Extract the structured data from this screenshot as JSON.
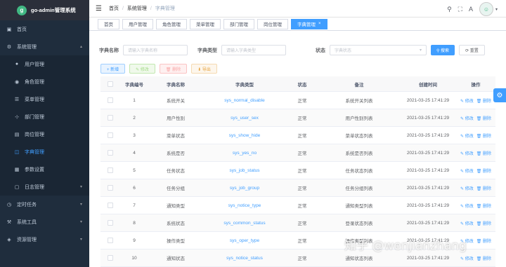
{
  "app": {
    "title": "go-admin管理系统",
    "logo_letter": "g"
  },
  "sidebar": {
    "items": [
      {
        "label": "首页",
        "icon": "dashboard-icon",
        "glyph": "▣",
        "level": "top"
      },
      {
        "label": "系统管理",
        "icon": "gear-icon",
        "glyph": "⚙",
        "level": "top",
        "arrow": "▴"
      },
      {
        "label": "用户管理",
        "icon": "user-icon",
        "glyph": "●",
        "level": "sub"
      },
      {
        "label": "角色管理",
        "icon": "role-icon",
        "glyph": "◉",
        "level": "sub"
      },
      {
        "label": "菜单管理",
        "icon": "menu-icon",
        "glyph": "☰",
        "level": "sub"
      },
      {
        "label": "部门管理",
        "icon": "tree-icon",
        "glyph": "⊹",
        "level": "sub"
      },
      {
        "label": "岗位管理",
        "icon": "post-icon",
        "glyph": "▤",
        "level": "sub"
      },
      {
        "label": "字典管理",
        "icon": "dict-icon",
        "glyph": "◫",
        "level": "sub",
        "active": true
      },
      {
        "label": "参数设置",
        "icon": "params-icon",
        "glyph": "▦",
        "level": "sub"
      },
      {
        "label": "日志管理",
        "icon": "log-icon",
        "glyph": "▢",
        "level": "sub",
        "arrow": "▾"
      },
      {
        "label": "定时任务",
        "icon": "clock-icon",
        "glyph": "◷",
        "level": "top",
        "arrow": "▾"
      },
      {
        "label": "系统工具",
        "icon": "tool-icon",
        "glyph": "⚒",
        "level": "top",
        "arrow": "▾"
      },
      {
        "label": "资源管理",
        "icon": "resource-icon",
        "glyph": "◈",
        "level": "top",
        "arrow": "▾"
      }
    ]
  },
  "header": {
    "hamburger": "☰",
    "breadcrumb": [
      "首页",
      "系统管理",
      "字典管理"
    ],
    "search_glyph": "⚲",
    "fullscreen_glyph": "⛶",
    "lang_glyph": "A",
    "avatar_glyph": "☺",
    "caret": "▾"
  },
  "tags": [
    {
      "label": "首页"
    },
    {
      "label": "用户管理"
    },
    {
      "label": "角色管理"
    },
    {
      "label": "菜单管理"
    },
    {
      "label": "部门管理"
    },
    {
      "label": "岗位管理"
    },
    {
      "label": "字典管理",
      "active": true,
      "close": "×"
    }
  ],
  "search": {
    "name_label": "字典名称",
    "name_placeholder": "请输入字典名称",
    "type_label": "字典类型",
    "type_placeholder": "请输入字典类型",
    "status_label": "状态",
    "status_placeholder": "字典状态",
    "status_caret": "▾",
    "search_btn": "⚲ 搜索",
    "reset_btn": "⟳ 重置"
  },
  "actions": {
    "add": "+ 新增",
    "edit": "✎ 修改",
    "delete": "🗑 删除",
    "export": "⬇ 导出"
  },
  "table": {
    "headers": [
      "字典编号",
      "字典名称",
      "字典类型",
      "状态",
      "备注",
      "创建时间",
      "操作"
    ],
    "edit_label": "✎ 修改",
    "delete_label": "🗑 删除",
    "rows": [
      {
        "id": "1",
        "name": "系统开关",
        "type": "sys_normal_disable",
        "status": "正常",
        "remark": "系统开关列表",
        "time": "2021-03-25 17:41:29"
      },
      {
        "id": "2",
        "name": "用户性别",
        "type": "sys_user_sex",
        "status": "正常",
        "remark": "用户性别列表",
        "time": "2021-03-25 17:41:29"
      },
      {
        "id": "3",
        "name": "菜单状态",
        "type": "sys_show_hide",
        "status": "正常",
        "remark": "菜单状态列表",
        "time": "2021-03-25 17:41:29"
      },
      {
        "id": "4",
        "name": "系统是否",
        "type": "sys_yes_no",
        "status": "正常",
        "remark": "系统是否列表",
        "time": "2021-03-25 17:41:29"
      },
      {
        "id": "5",
        "name": "任务状态",
        "type": "sys_job_status",
        "status": "正常",
        "remark": "任务状态列表",
        "time": "2021-03-25 17:41:29"
      },
      {
        "id": "6",
        "name": "任务分组",
        "type": "sys_job_group",
        "status": "正常",
        "remark": "任务分组列表",
        "time": "2021-03-25 17:41:29"
      },
      {
        "id": "7",
        "name": "通知类型",
        "type": "sys_notice_type",
        "status": "正常",
        "remark": "通知类型列表",
        "time": "2021-03-25 17:41:29"
      },
      {
        "id": "8",
        "name": "系统状态",
        "type": "sys_common_status",
        "status": "正常",
        "remark": "登录状态列表",
        "time": "2021-03-25 17:41:29"
      },
      {
        "id": "9",
        "name": "操作类型",
        "type": "sys_oper_type",
        "status": "正常",
        "remark": "操作类型列表",
        "time": "2021-03-25 17:41:29"
      },
      {
        "id": "10",
        "name": "通知状态",
        "type": "sys_notice_status",
        "status": "正常",
        "remark": "通知状态列表",
        "time": "2021-03-25 17:41:29"
      }
    ]
  },
  "settings_glyph": "⚙",
  "watermark": "知乎 @wenjianzhang"
}
